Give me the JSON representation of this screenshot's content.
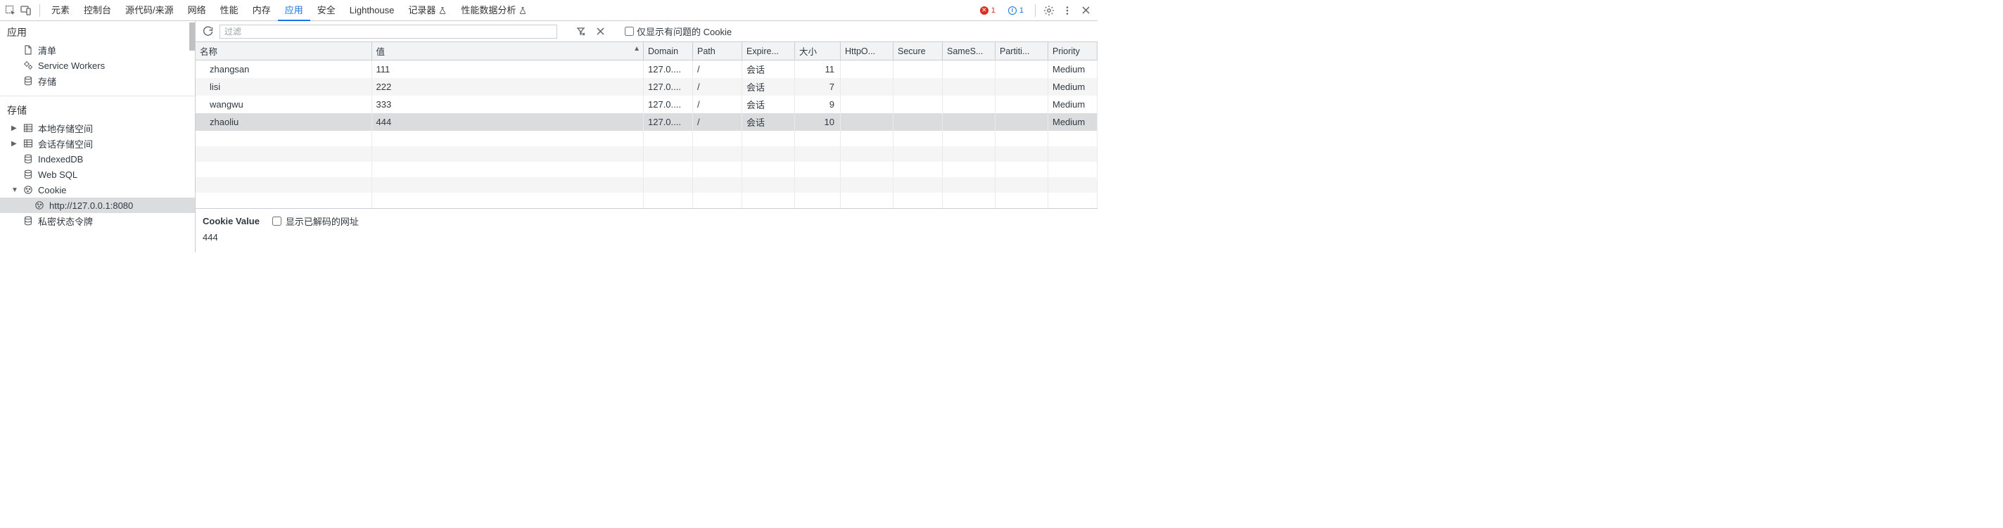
{
  "tabs": {
    "elements": "元素",
    "console": "控制台",
    "sources": "源代码/来源",
    "network": "网络",
    "performance": "性能",
    "memory": "内存",
    "application": "应用",
    "security": "安全",
    "lighthouse": "Lighthouse",
    "recorder": "记录器",
    "perf_insights": "性能数据分析"
  },
  "errors_count": "1",
  "info_count": "1",
  "sidebar": {
    "group_application": "应用",
    "manifest": "清单",
    "service_workers": "Service Workers",
    "storage": "存储",
    "group_storage": "存储",
    "local_storage": "本地存储空间",
    "session_storage": "会话存储空间",
    "indexeddb": "IndexedDB",
    "websql": "Web SQL",
    "cookie": "Cookie",
    "cookie_origin": "http://127.0.0.1:8080",
    "private_tokens": "私密状态令牌"
  },
  "toolbar": {
    "filter_placeholder": "过滤",
    "only_issues": "仅显示有问题的 Cookie"
  },
  "columns": {
    "name": "名称",
    "value": "值",
    "domain": "Domain",
    "path": "Path",
    "expires": "Expire...",
    "size": "大小",
    "httponly": "HttpO...",
    "secure": "Secure",
    "samesite": "SameS...",
    "partition": "Partiti...",
    "priority": "Priority"
  },
  "rows": [
    {
      "name": "zhangsan",
      "value": "111",
      "domain": "127.0....",
      "path": "/",
      "expires": "会话",
      "size": "11",
      "httponly": "",
      "secure": "",
      "samesite": "",
      "partition": "",
      "priority": "Medium"
    },
    {
      "name": "lisi",
      "value": "222",
      "domain": "127.0....",
      "path": "/",
      "expires": "会话",
      "size": "7",
      "httponly": "",
      "secure": "",
      "samesite": "",
      "partition": "",
      "priority": "Medium"
    },
    {
      "name": "wangwu",
      "value": "333",
      "domain": "127.0....",
      "path": "/",
      "expires": "会话",
      "size": "9",
      "httponly": "",
      "secure": "",
      "samesite": "",
      "partition": "",
      "priority": "Medium"
    },
    {
      "name": "zhaoliu",
      "value": "444",
      "domain": "127.0....",
      "path": "/",
      "expires": "会话",
      "size": "10",
      "httponly": "",
      "secure": "",
      "samesite": "",
      "partition": "",
      "priority": "Medium"
    }
  ],
  "selected_row_index": 3,
  "detail": {
    "header": "Cookie Value",
    "decoded_label": "显示已解码的网址",
    "value": "444"
  }
}
